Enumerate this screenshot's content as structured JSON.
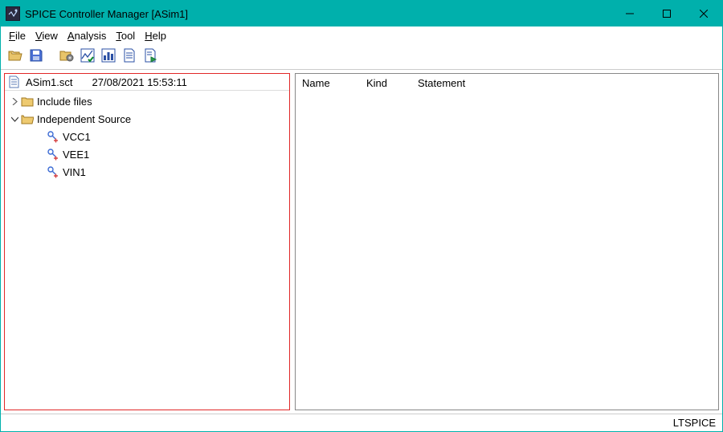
{
  "window": {
    "title": "SPICE Controller Manager [ASim1]"
  },
  "menu": {
    "file": "File",
    "view": "View",
    "analysis": "Analysis",
    "tool": "Tool",
    "help": "Help"
  },
  "tree": {
    "filename": "ASim1.sct",
    "timestamp": "27/08/2021 15:53:11",
    "nodes": {
      "include_files": {
        "label": "Include files",
        "expanded": false
      },
      "independent_source": {
        "label": "Independent Source",
        "expanded": true,
        "children": [
          {
            "label": "VCC1"
          },
          {
            "label": "VEE1"
          },
          {
            "label": "VIN1"
          }
        ]
      }
    }
  },
  "list": {
    "columns": {
      "name": "Name",
      "kind": "Kind",
      "statement": "Statement"
    }
  },
  "status": {
    "engine": "LTSPICE"
  }
}
